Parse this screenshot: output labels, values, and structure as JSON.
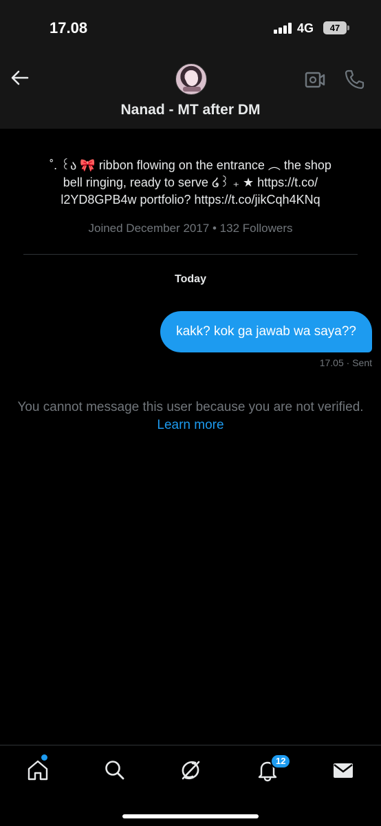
{
  "status_bar": {
    "time": "17.08",
    "network": "4G",
    "battery": "47"
  },
  "header": {
    "title": "Nanad - MT after DM",
    "icons": [
      "back-arrow-icon",
      "video-call-icon",
      "phone-icon"
    ]
  },
  "profile": {
    "bio_line1": "˚. ꒰ა 🎀 ribbon flowing on the entrance ︵ the shop",
    "bio_line2": "bell ringing, ready to serve ໒꒱ ₊ ★ https://t.co/",
    "bio_line3": "l2YD8GPB4w portfolio? https://t.co/jikCqh4KNq",
    "joined": "Joined December 2017 • 132 Followers"
  },
  "conversation": {
    "date_divider": "Today",
    "messages": [
      {
        "text": "kakk? kok ga jawab wa saya??",
        "time": "17.05",
        "status": "· Sent",
        "outgoing": true
      }
    ],
    "notice_text": "You cannot message this user because you are not verified.",
    "notice_link": "Learn more"
  },
  "bottom_nav": {
    "notification_count": "12",
    "accent_color": "#1d9bf0",
    "icons": [
      "home-icon",
      "search-icon",
      "grok-icon",
      "notifications-icon",
      "messages-icon"
    ]
  }
}
